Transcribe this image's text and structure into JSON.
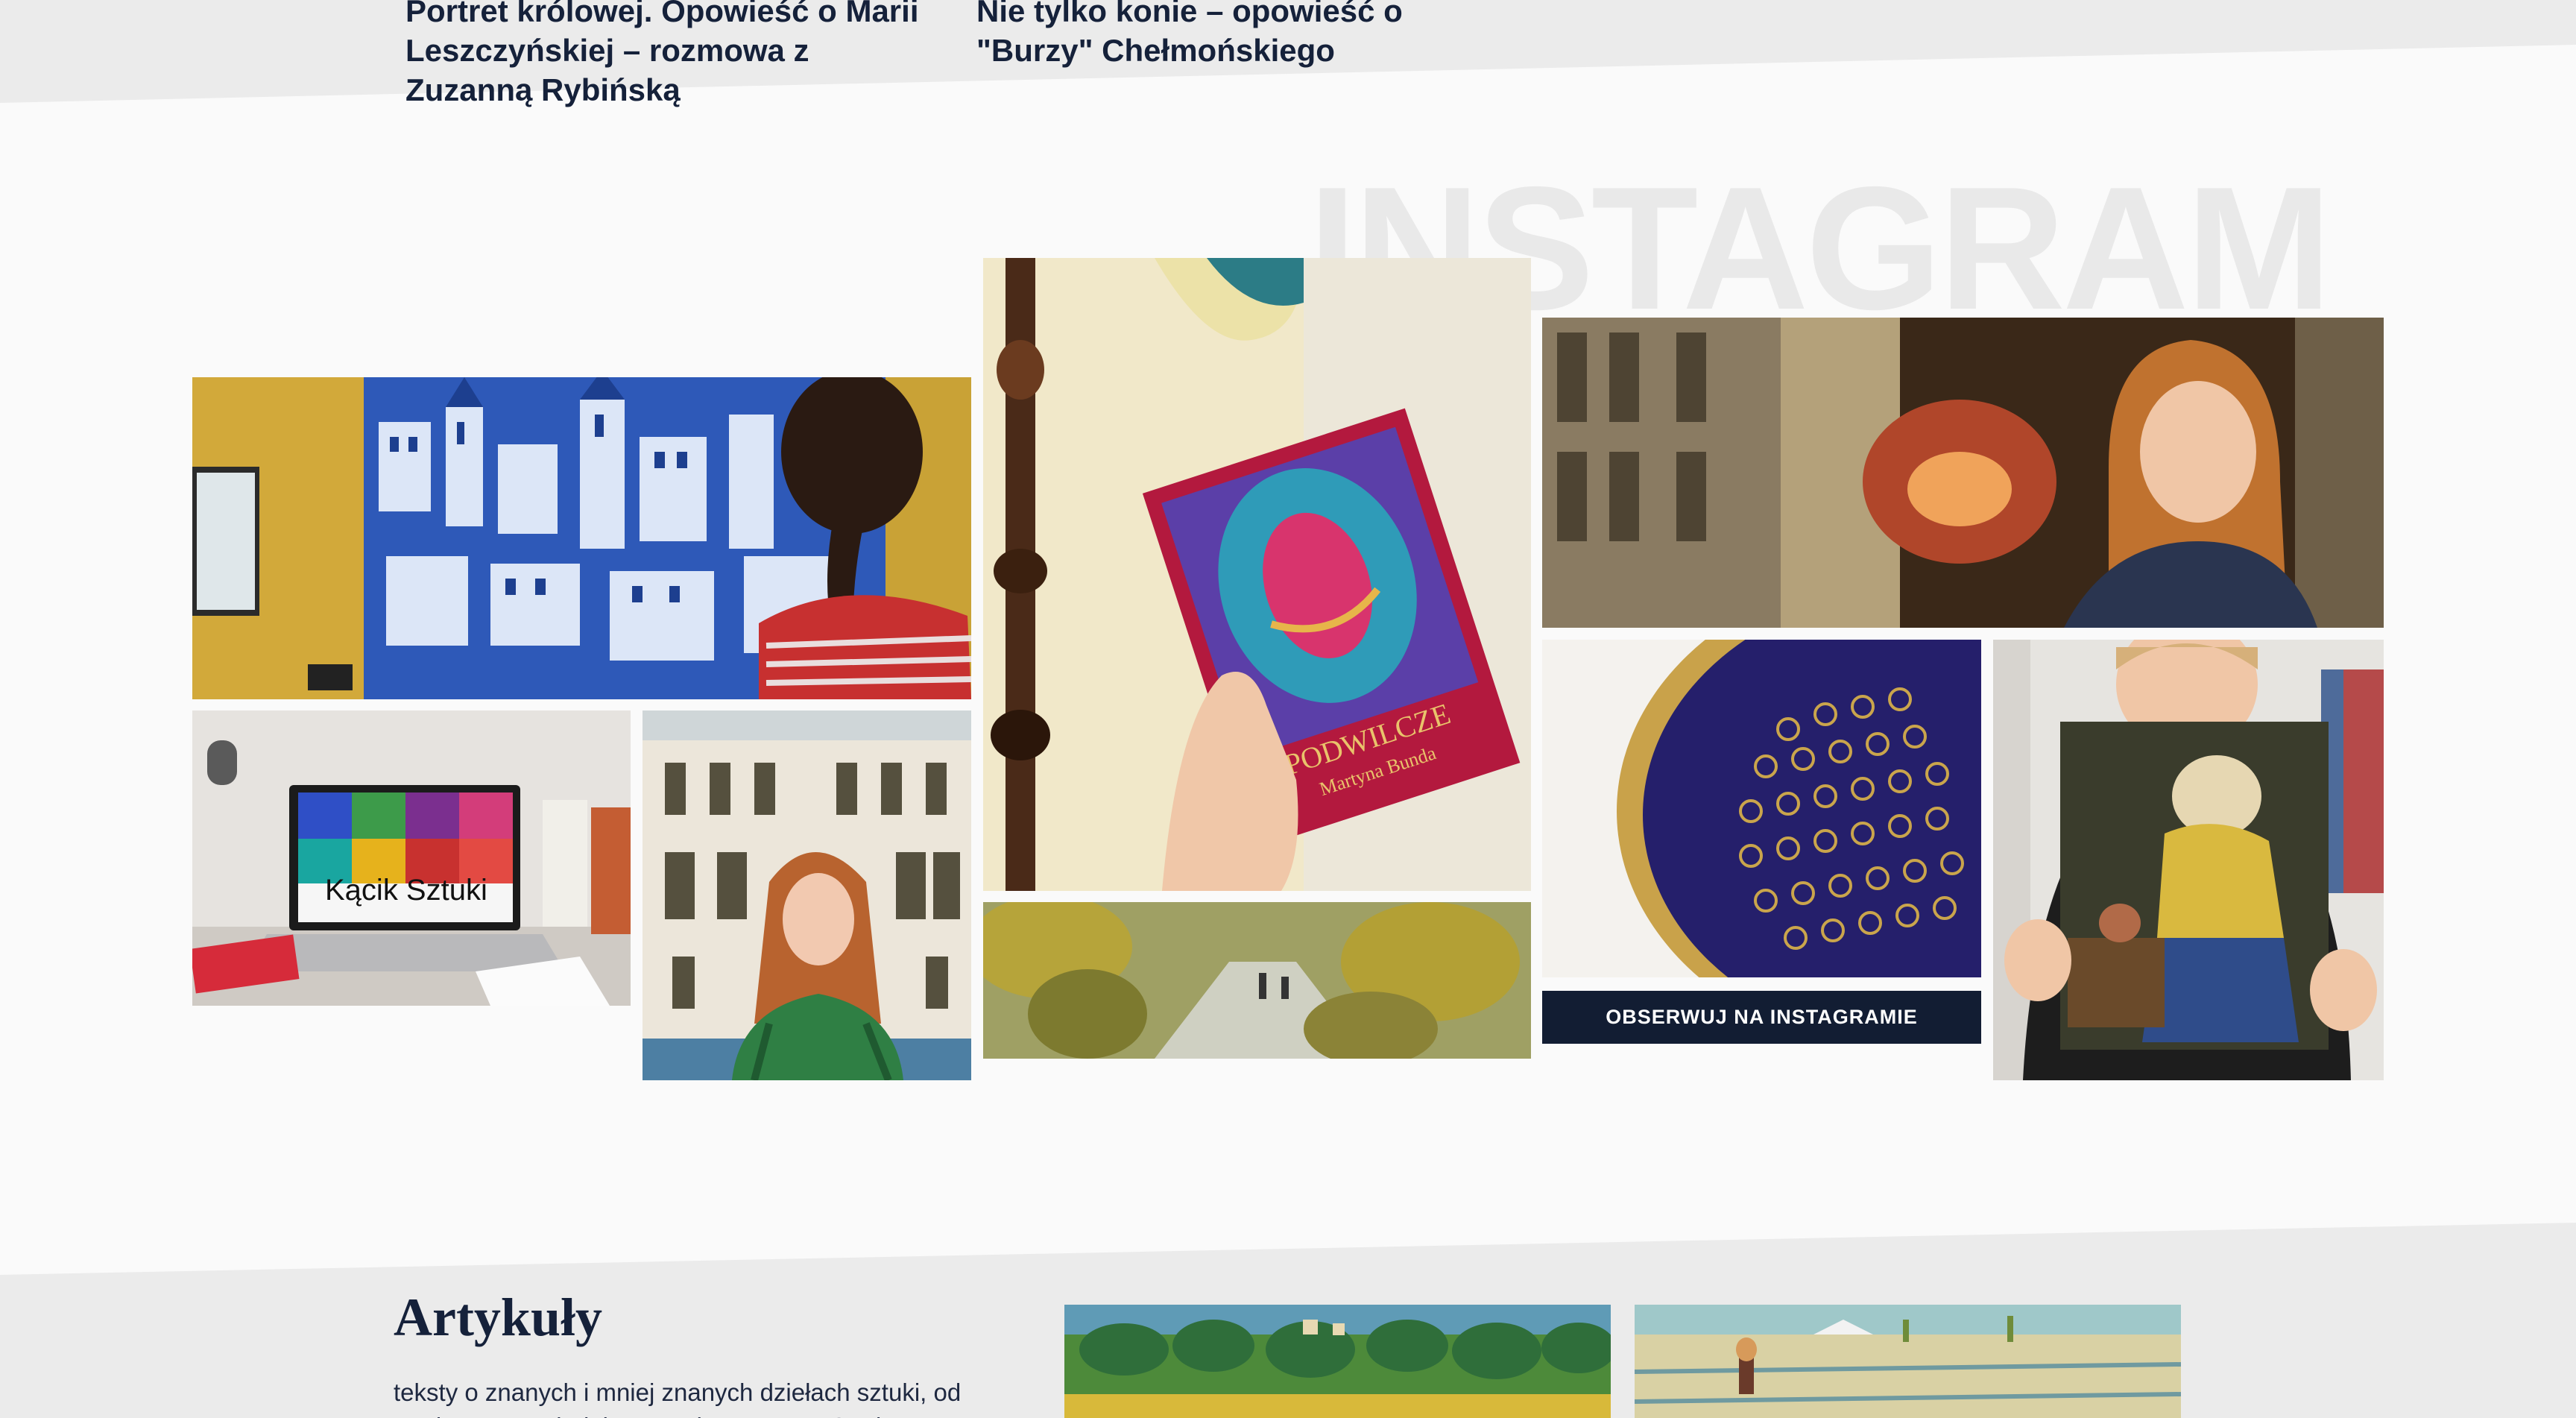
{
  "posts": {
    "post1_title": "Portret królowej. Opowieść o Marii Leszczyńskiej – rozmowa z Zuzanną Rybińską",
    "post2_title": "Nie tylko konie – opowieść o \"Burzy\" Chełmońskiego"
  },
  "instagram": {
    "heading": "INSTAGRAM",
    "laptop_caption": "Kącik Sztuki",
    "book_title": "PODWILCZE",
    "book_author": "Martyna Bunda",
    "follow_button": "OBSERWUJ NA INSTAGRAMIE"
  },
  "articles": {
    "title": "Artykuły",
    "description": "teksty o znanych i mniej znanych dziełach sztuki, od „Kwitnącego migdałowca” Vincenta van Gogha, po"
  },
  "colors": {
    "navy": "#121d33",
    "band": "#ebebeb",
    "background": "#fafafa"
  }
}
